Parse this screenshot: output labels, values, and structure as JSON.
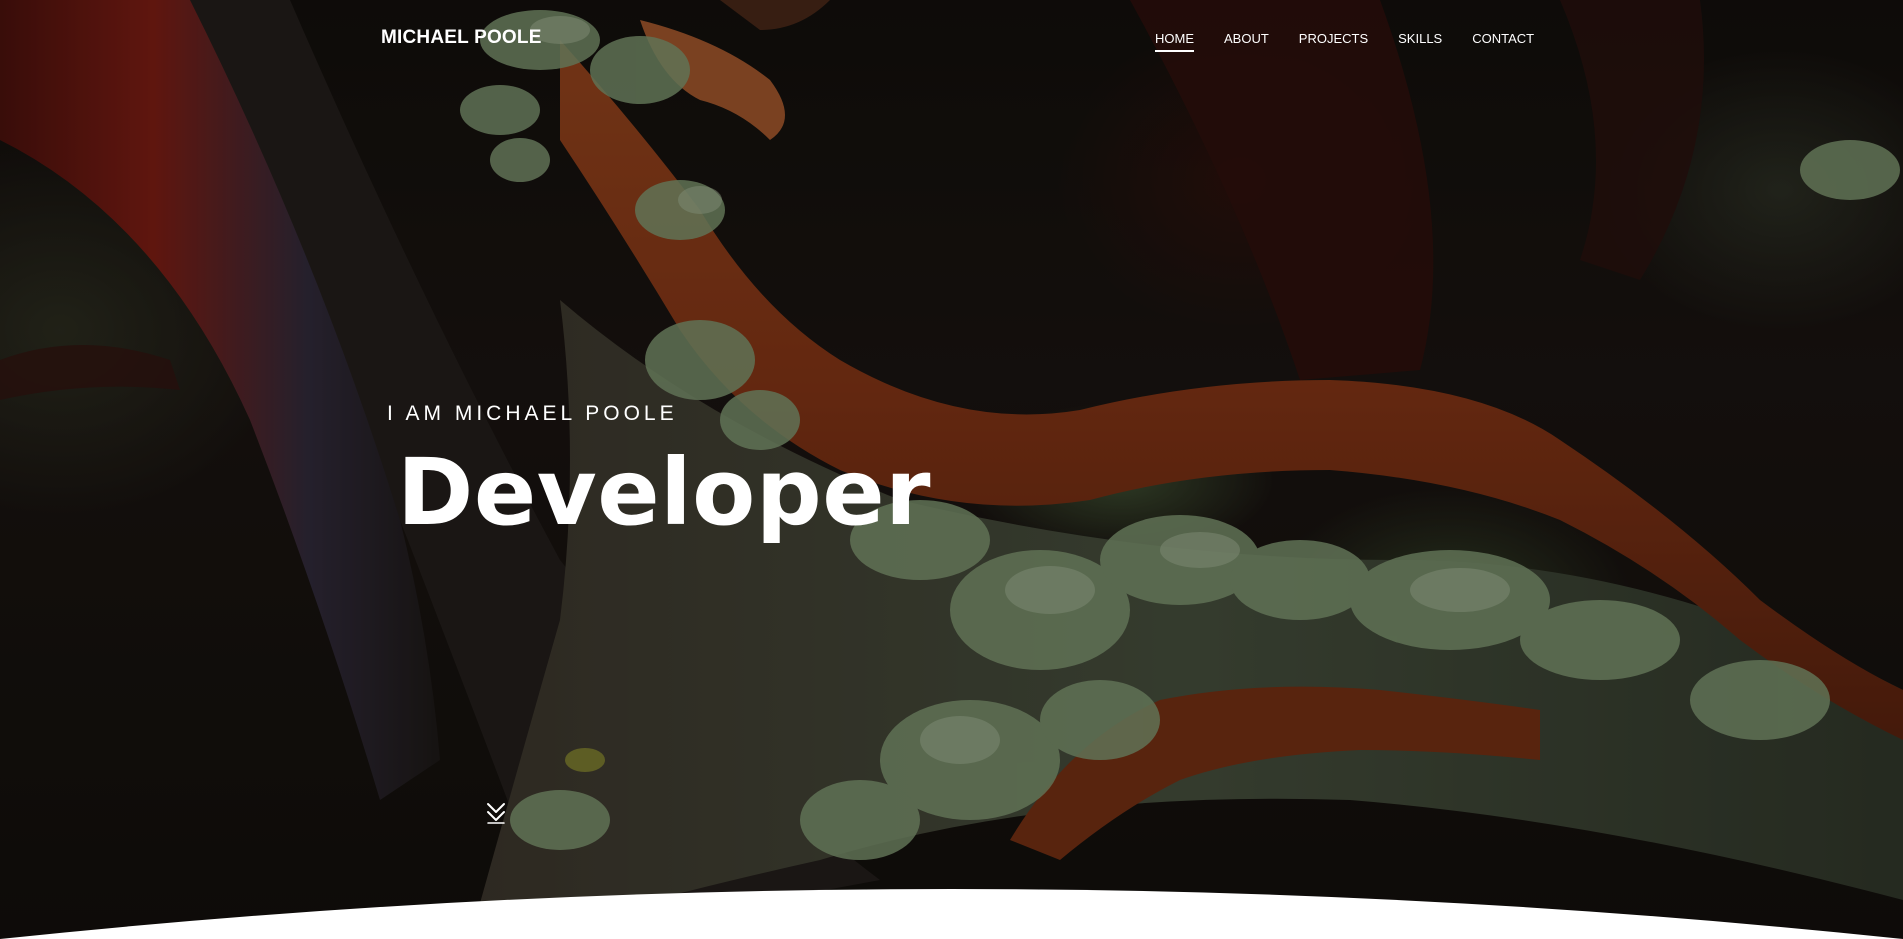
{
  "brand": {
    "name": "MICHAEL POOLE"
  },
  "nav": {
    "items": [
      {
        "label": "HOME",
        "active": true
      },
      {
        "label": "ABOUT",
        "active": false
      },
      {
        "label": "PROJECTS",
        "active": false
      },
      {
        "label": "SKILLS",
        "active": false
      },
      {
        "label": "CONTACT",
        "active": false
      }
    ]
  },
  "hero": {
    "subtitle": "I AM MICHAEL POOLE",
    "title": "Developer",
    "scroll_icon": "double-chevron-down-icon",
    "background_image": "lichen-covered-tree-branch"
  },
  "colors": {
    "text": "#ffffff",
    "bark_red": "#a8461e",
    "lichen_green": "#8fae7c",
    "bottom_curve": "#ffffff"
  }
}
